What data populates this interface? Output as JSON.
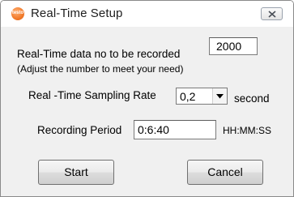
{
  "window": {
    "title": "Real-Time Setup",
    "icon_text": "testo",
    "close_icon": "close-x-icon"
  },
  "records": {
    "label": "Real-Time data no to be recorded",
    "hint": "(Adjust the number to meet your need)",
    "value": "2000"
  },
  "sampling": {
    "label": "Real -Time Sampling Rate",
    "selected": "0,2",
    "unit": "second"
  },
  "period": {
    "label": "Recording Period",
    "value": "0:6:40",
    "format": "HH:MM:SS"
  },
  "buttons": {
    "start": "Start",
    "cancel": "Cancel"
  }
}
